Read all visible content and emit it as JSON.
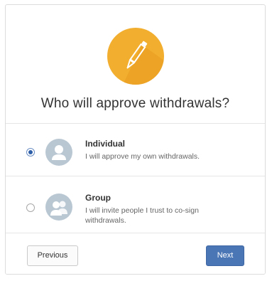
{
  "dialog": {
    "title": "Who will approve withdrawals?",
    "hero_icon": "pencil-icon",
    "accent_color": "#f2ae2e"
  },
  "options": [
    {
      "title": "Individual",
      "description": "I will approve my own withdrawals.",
      "selected": true,
      "icon": "person-icon"
    },
    {
      "title": "Group",
      "description": "I will invite people I trust to co-sign withdrawals.",
      "selected": false,
      "icon": "group-icon"
    }
  ],
  "footer": {
    "previous_label": "Previous",
    "next_label": "Next",
    "next_color": "#4a76b5"
  }
}
